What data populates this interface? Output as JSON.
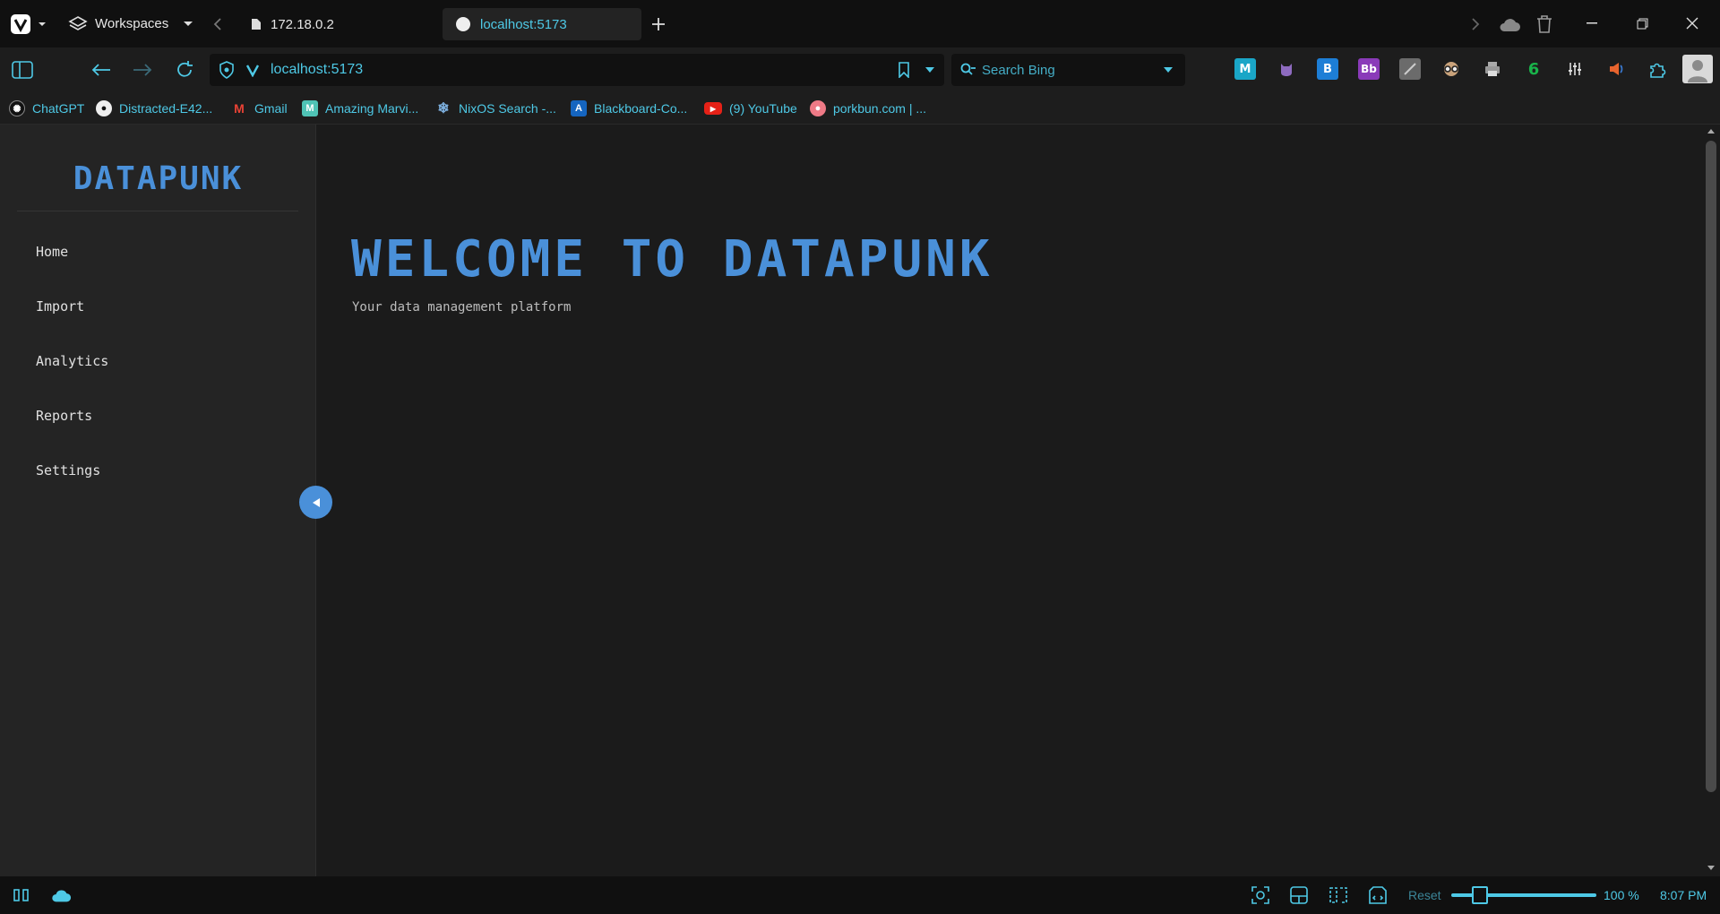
{
  "tabbar": {
    "workspaces_label": "Workspaces",
    "tabs": [
      {
        "label": "172.18.0.2",
        "active": false
      },
      {
        "label": "localhost:5173",
        "active": true
      }
    ]
  },
  "addressbar": {
    "url": "localhost:5173",
    "search_placeholder": "Search Bing"
  },
  "extensions": [
    {
      "name": "m-extension-icon",
      "glyph": "M",
      "bg": "#1aa6c7"
    },
    {
      "name": "purple-cat-extension-icon",
      "glyph": "",
      "bg": "transparent"
    },
    {
      "name": "b-arrow-extension-icon",
      "glyph": "B",
      "bg": "#1d7ed6"
    },
    {
      "name": "bb-extension-icon",
      "glyph": "Bb",
      "bg": "#8a3ab9"
    },
    {
      "name": "slash-extension-icon",
      "glyph": "",
      "bg": "#777"
    },
    {
      "name": "glasses-extension-icon",
      "glyph": "",
      "bg": "transparent"
    },
    {
      "name": "printer-extension-icon",
      "glyph": "",
      "bg": "transparent"
    },
    {
      "name": "six-extension-icon",
      "glyph": "6",
      "bg": "transparent"
    },
    {
      "name": "equalizer-extension-icon",
      "glyph": "",
      "bg": "transparent"
    },
    {
      "name": "speaker-extension-icon",
      "glyph": "",
      "bg": "transparent"
    }
  ],
  "bookmarks": [
    {
      "label": "ChatGPT",
      "icon": "chatgpt-icon"
    },
    {
      "label": "Distracted-E42...",
      "icon": "github-icon"
    },
    {
      "label": "Gmail",
      "icon": "gmail-icon"
    },
    {
      "label": "Amazing Marvi...",
      "icon": "marvin-icon"
    },
    {
      "label": "NixOS Search -...",
      "icon": "nixos-icon"
    },
    {
      "label": "Blackboard-Co...",
      "icon": "blackboard-icon"
    },
    {
      "label": "(9) YouTube",
      "icon": "youtube-icon"
    },
    {
      "label": "porkbun.com | ...",
      "icon": "porkbun-icon"
    }
  ],
  "app": {
    "logo": "DATAPUNK",
    "nav": [
      "Home",
      "Import",
      "Analytics",
      "Reports",
      "Settings"
    ],
    "title": "WELCOME TO DATAPUNK",
    "subtitle": "Your data management platform"
  },
  "statusbar": {
    "reset_label": "Reset",
    "zoom": "100 %",
    "zoom_value": 100,
    "time": "8:07 PM"
  },
  "colors": {
    "accent": "#4ec9e6",
    "brand": "#4a90d9",
    "sidebar_bg": "#242424",
    "main_bg": "#1b1b1b"
  }
}
